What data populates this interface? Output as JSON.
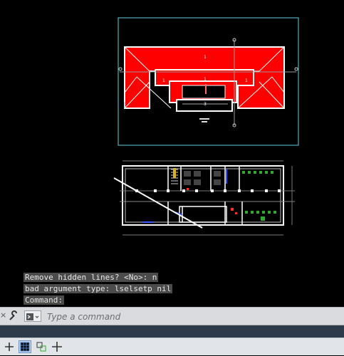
{
  "history": [
    "Remove hidden lines? <No>: n",
    "bad argument type: lselsetp nil",
    "Command:"
  ],
  "command": {
    "placeholder": "Type a command"
  },
  "drawing": {
    "roof_marks": [
      "1",
      "1",
      "1",
      "1"
    ],
    "elevation_label": "3"
  },
  "colors": {
    "roof_red": "#ff0000",
    "viewport_border": "#5fd3e0",
    "wall": "#ffffff",
    "furniture_green": "#2fa82f",
    "furniture_blue": "#2b5bff"
  },
  "statusbar": {
    "buttons": [
      "model-space-icon",
      "grid-icon",
      "snap-mode-icon",
      "orthogonal-icon"
    ]
  }
}
